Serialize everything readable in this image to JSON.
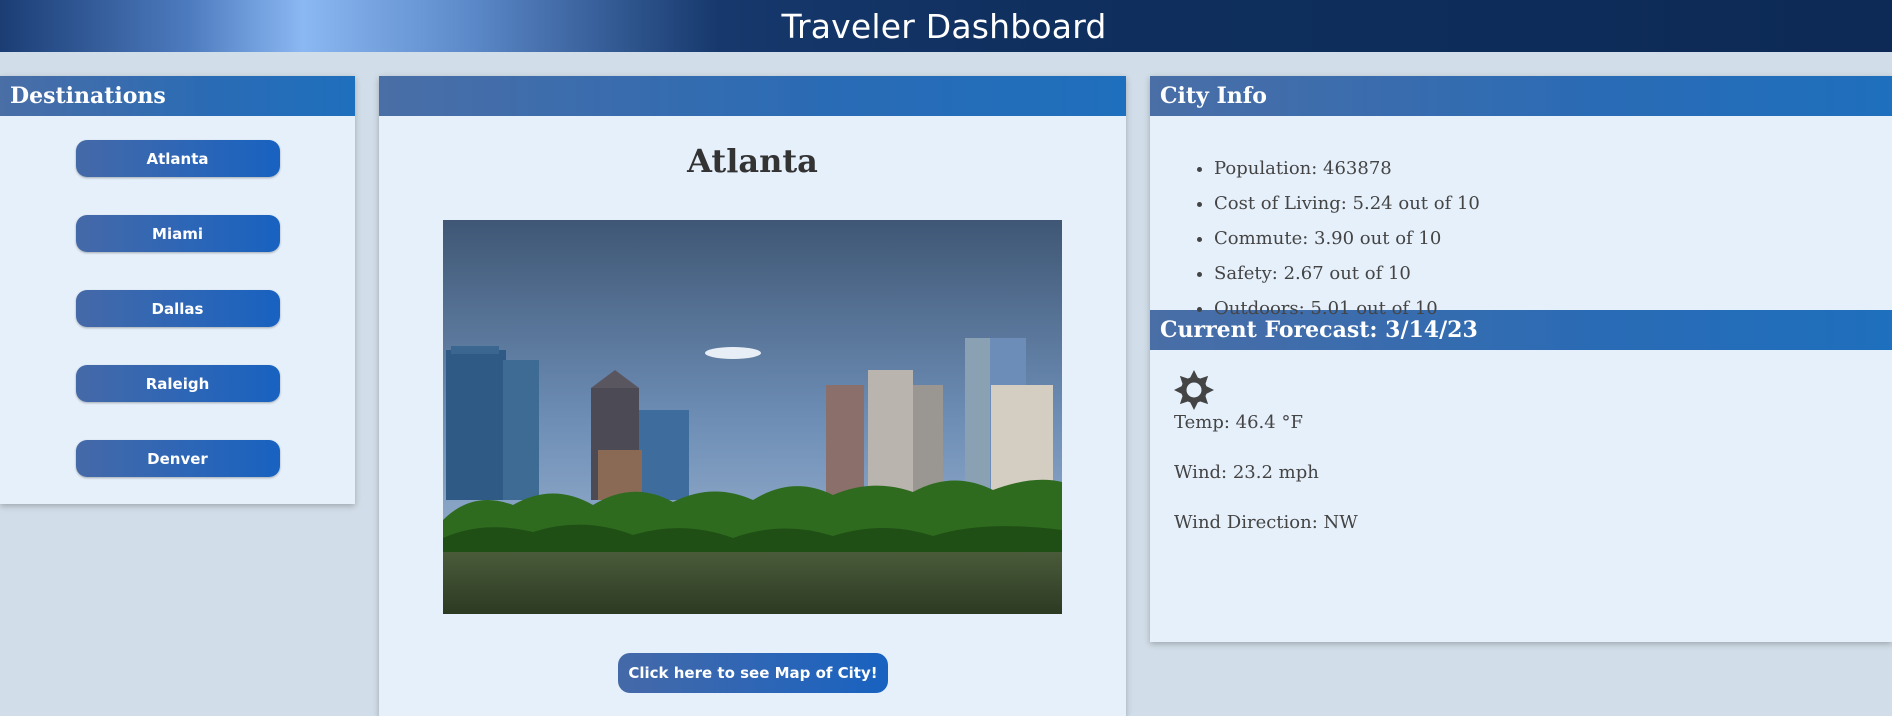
{
  "header": {
    "title": "Traveler Dashboard"
  },
  "destinations": {
    "title": "Destinations",
    "items": [
      "Atlanta",
      "Miami",
      "Dallas",
      "Raleigh",
      "Denver"
    ]
  },
  "city": {
    "header_label": "",
    "name": "Atlanta",
    "map_button": "Click here to see Map of City!"
  },
  "city_info": {
    "title": "City Info",
    "items": [
      "Population: 463878",
      "Cost of Living: 5.24 out of 10",
      "Commute: 3.90 out of 10",
      "Safety: 2.67 out of 10",
      "Outdoors: 5.01 out of 10"
    ]
  },
  "forecast": {
    "title": "Current Forecast: 3/14/23",
    "icon": "sun-icon",
    "temp": "Temp: 46.4 °F",
    "wind": "Wind: 23.2 mph",
    "wind_direction": "Wind Direction: NW"
  },
  "colors": {
    "header_dark": "#0d2a56",
    "panel_bg": "#e6f0fb",
    "button_blue": "#1862c0",
    "page_bg": "#d1dde8"
  }
}
